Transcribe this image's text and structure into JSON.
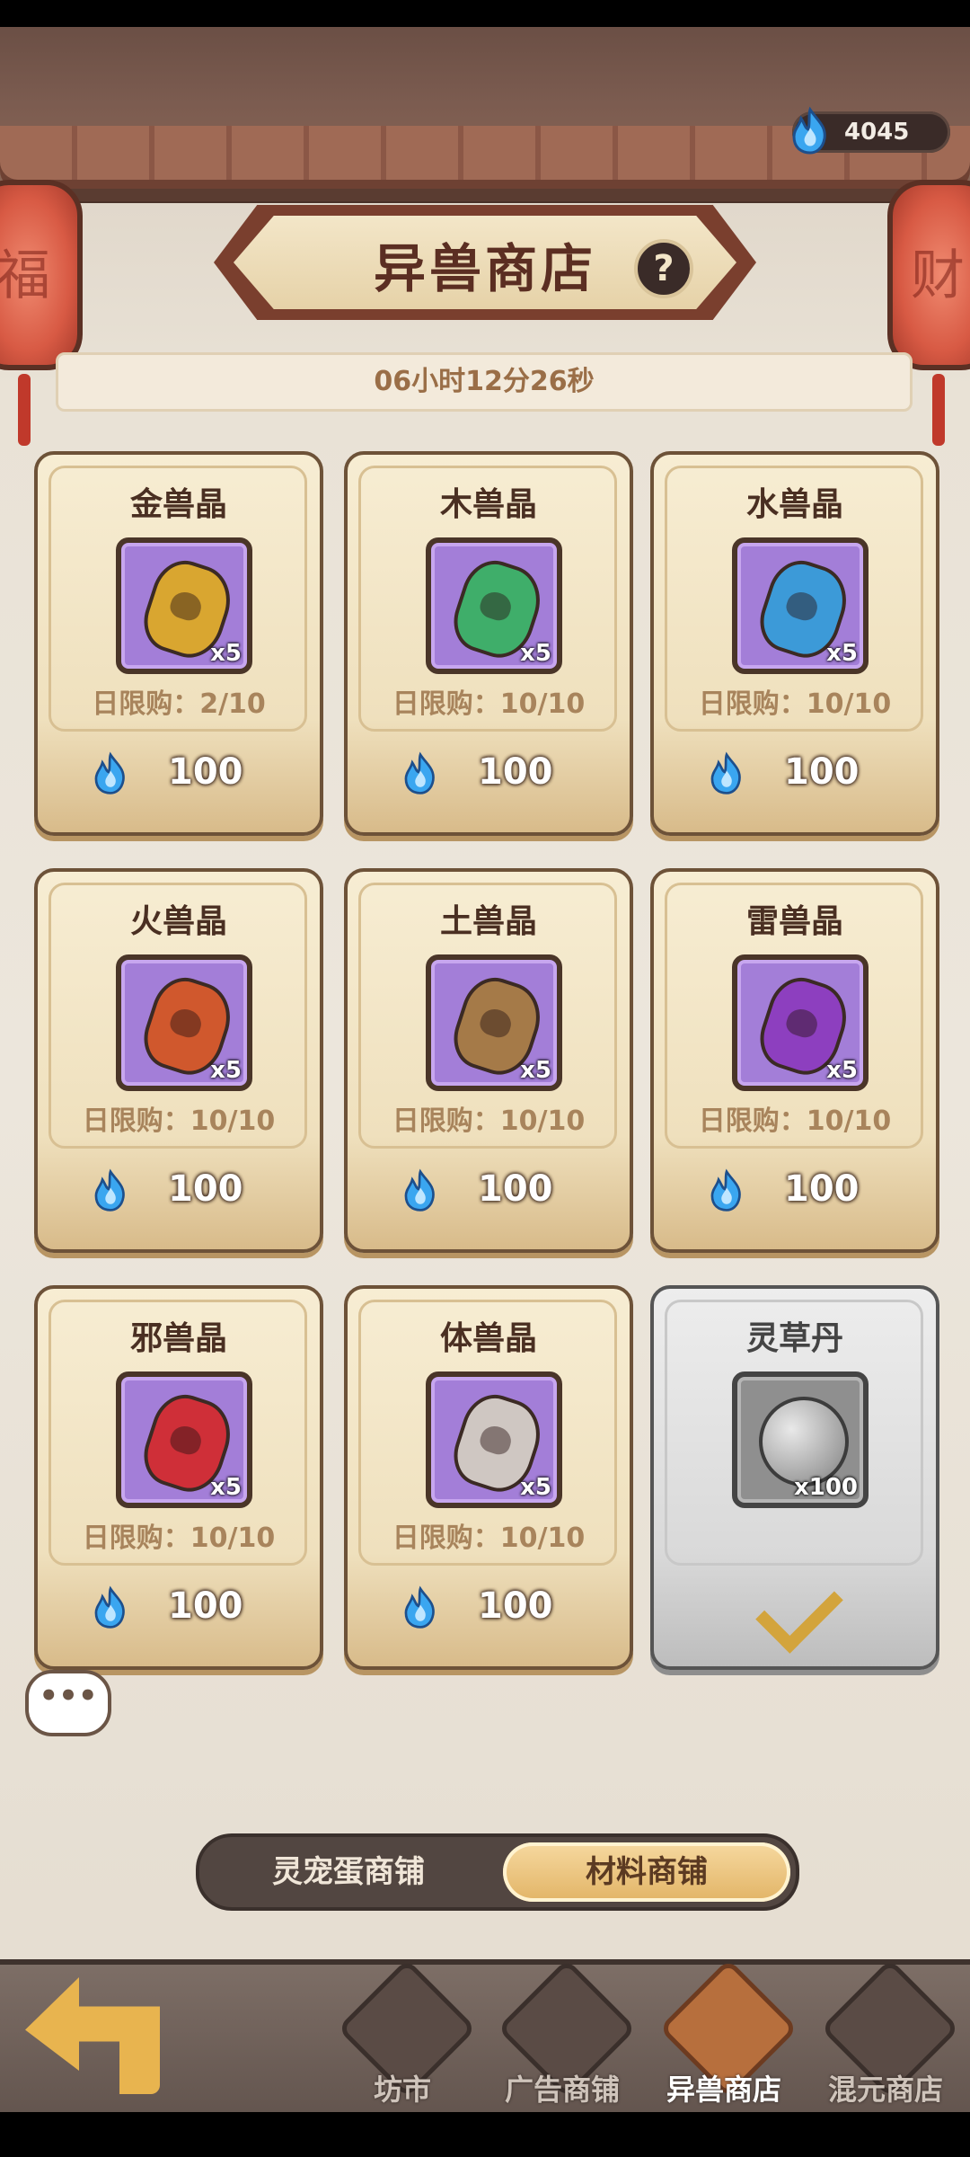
{
  "currency": {
    "amount": "4045"
  },
  "header": {
    "title": "异兽商店",
    "help": "?",
    "lantern_left": "福",
    "lantern_right": "财"
  },
  "timer": "06小时12分26秒",
  "items": [
    {
      "name": "金兽晶",
      "qty": "x5",
      "limit": "日限购：2/10",
      "price": "100",
      "color": "#d9a630"
    },
    {
      "name": "木兽晶",
      "qty": "x5",
      "limit": "日限购：10/10",
      "price": "100",
      "color": "#3fae6a"
    },
    {
      "name": "水兽晶",
      "qty": "x5",
      "limit": "日限购：10/10",
      "price": "100",
      "color": "#3c9ad8"
    },
    {
      "name": "火兽晶",
      "qty": "x5",
      "limit": "日限购：10/10",
      "price": "100",
      "color": "#d0582d"
    },
    {
      "name": "土兽晶",
      "qty": "x5",
      "limit": "日限购：10/10",
      "price": "100",
      "color": "#a57a48"
    },
    {
      "name": "雷兽晶",
      "qty": "x5",
      "limit": "日限购：10/10",
      "price": "100",
      "color": "#8d3fbf"
    },
    {
      "name": "邪兽晶",
      "qty": "x5",
      "limit": "日限购：10/10",
      "price": "100",
      "color": "#cf2f38"
    },
    {
      "name": "体兽晶",
      "qty": "x5",
      "limit": "日限购：10/10",
      "price": "100",
      "color": "#cfc7c2"
    },
    {
      "name": "灵草丹",
      "qty": "x100",
      "sold_out": true
    }
  ],
  "chat": "•••",
  "shop_tabs": {
    "left": "灵宠蛋商铺",
    "right": "材料商铺",
    "active": "right"
  },
  "nav": [
    {
      "label": "坊市"
    },
    {
      "label": "广告商铺"
    },
    {
      "label": "异兽商店",
      "active": true
    },
    {
      "label": "混元商店"
    }
  ],
  "icons": {
    "currency": "blue-flame-icon",
    "help": "question-icon",
    "back": "back-arrow-icon",
    "sold_out": "checkmark-icon"
  }
}
